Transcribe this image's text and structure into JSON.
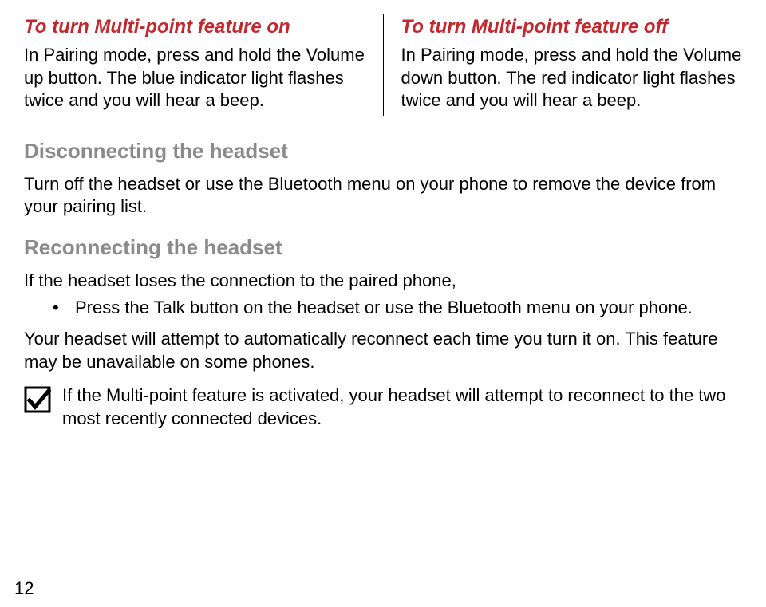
{
  "multipoint": {
    "on": {
      "heading": "To turn Multi-point feature on",
      "body": "In Pairing mode, press and hold the Volume up button. The blue indicator light flashes twice and you will hear a beep."
    },
    "off": {
      "heading": "To turn Multi-point feature off",
      "body": "In Pairing mode, press and hold the Volume down button. The red indicator light flashes twice and you will hear a beep."
    }
  },
  "disconnect": {
    "heading": "Disconnecting the headset",
    "body": "Turn off the headset or use the Bluetooth menu on your phone to remove the device from your pairing list."
  },
  "reconnect": {
    "heading": "Reconnecting the headset",
    "intro": "If the headset loses the connection to the paired phone,",
    "bullet": "Press the Talk button on the headset or use the Bluetooth menu on your phone.",
    "after": "Your headset will attempt to automatically reconnect each time you turn it on. This feature may be unavailable on some phones.",
    "note": "If the Multi-point feature is activated, your headset will attempt to reconnect to the two most recently connected devices."
  },
  "page_number": "12"
}
